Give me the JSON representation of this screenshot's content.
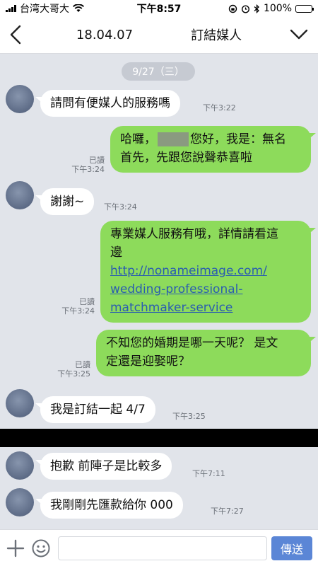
{
  "status_bar": {
    "carrier": "台湾大哥大",
    "time": "下午8:57",
    "battery_pct": "100%",
    "battery_level": 1.0
  },
  "header": {
    "date_code": "18.04.07",
    "title_suffix": "訂結媒人",
    "back_icon": "chevron-left-icon",
    "menu_icon": "chevron-down-icon"
  },
  "chat": {
    "date_separator": "9/27（三）",
    "messages": [
      {
        "side": "in",
        "text": "請問有便媒人的服務嗎",
        "time": "下午3:22"
      },
      {
        "side": "out",
        "line1_pre": "哈囉，",
        "line1_post": "您好，我是：無名",
        "line2": "首先，先跟您說聲恭喜啦",
        "read": "已讀",
        "time": "下午3:24"
      },
      {
        "side": "in",
        "text": "謝謝~",
        "time": "下午3:24"
      },
      {
        "side": "out",
        "line1": "專業媒人服務有哦，詳情請看這",
        "line2": "邊",
        "link1": "http://nonameimage.com/",
        "link2": "wedding-professional-",
        "link3": "matchmaker-service",
        "read": "已讀",
        "time": "下午3:24"
      },
      {
        "side": "out",
        "line1": "不知您的婚期是哪一天呢？ 是文",
        "line2": "定還是迎娶呢？",
        "read": "已讀",
        "time": "下午3:25"
      },
      {
        "side": "in",
        "text": "我是訂結一起 4/7",
        "time": "下午3:25"
      },
      {
        "side": "in",
        "text": "抱歉 前陣子是比較多",
        "time": "下午7:11"
      },
      {
        "side": "in",
        "text": "我剛剛先匯款給你  000",
        "time": "下午7:27"
      }
    ]
  },
  "input_bar": {
    "plus_icon": "plus-icon",
    "emoji_icon": "emoji-icon",
    "send_label": "傳送",
    "input_value": "",
    "input_placeholder": ""
  },
  "colors": {
    "chat_bg": "#e1e4ea",
    "outgoing_bubble": "#8ddb5b",
    "incoming_bubble": "#ffffff",
    "send_button": "#5b86d6",
    "link": "#2a5db0"
  }
}
